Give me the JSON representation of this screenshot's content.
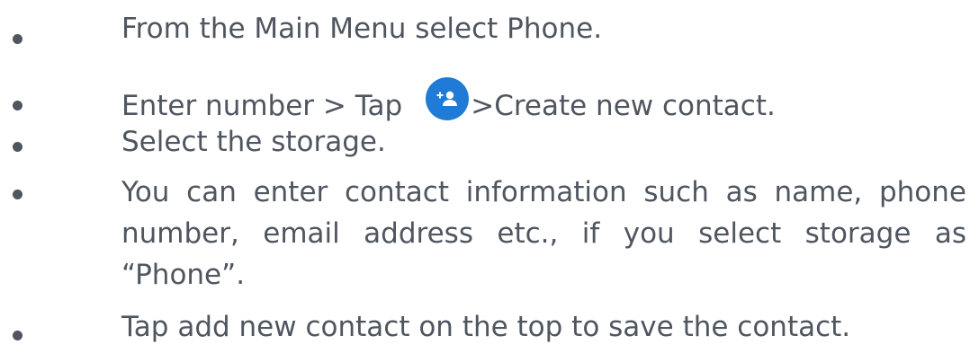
{
  "instructions": [
    {
      "text": "From the Main Menu select Phone."
    },
    {
      "text_before": "Enter number > Tap",
      "icon": "add-contact-icon",
      "text_after": ">Create new contact."
    },
    {
      "text": "Select the storage."
    },
    {
      "text": "You can enter contact information such as name, phone number, email address etc., if you select storage as “Phone”."
    },
    {
      "text": "Tap add new contact on the top to save the contact."
    }
  ],
  "colors": {
    "text": "#4f5660",
    "icon_background": "#1f7bd6",
    "icon_glyph": "#ffffff"
  }
}
